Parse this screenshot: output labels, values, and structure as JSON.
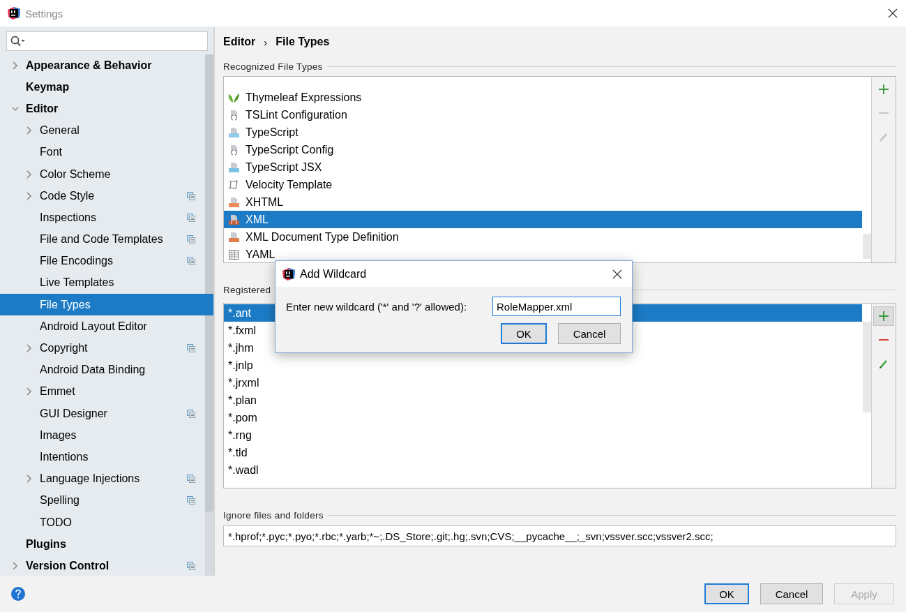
{
  "window": {
    "title": "Settings"
  },
  "sidebar": {
    "items": [
      {
        "label": "Appearance & Behavior",
        "kind": "collapsed",
        "project_level": false,
        "selected": false
      },
      {
        "label": "Keymap",
        "kind": "leaf",
        "project_level": false,
        "selected": false
      },
      {
        "label": "Editor",
        "kind": "expanded",
        "project_level": false,
        "selected": false,
        "children": [
          {
            "label": "General",
            "kind": "collapsed",
            "project_level": false,
            "selected": false
          },
          {
            "label": "Font",
            "kind": "leaf",
            "project_level": false,
            "selected": false
          },
          {
            "label": "Color Scheme",
            "kind": "collapsed",
            "project_level": false,
            "selected": false
          },
          {
            "label": "Code Style",
            "kind": "collapsed",
            "project_level": true,
            "selected": false
          },
          {
            "label": "Inspections",
            "kind": "leaf",
            "project_level": true,
            "selected": false
          },
          {
            "label": "File and Code Templates",
            "kind": "leaf",
            "project_level": true,
            "selected": false
          },
          {
            "label": "File Encodings",
            "kind": "leaf",
            "project_level": true,
            "selected": false
          },
          {
            "label": "Live Templates",
            "kind": "leaf",
            "project_level": false,
            "selected": false
          },
          {
            "label": "File Types",
            "kind": "leaf",
            "project_level": false,
            "selected": true
          },
          {
            "label": "Android Layout Editor",
            "kind": "leaf",
            "project_level": false,
            "selected": false
          },
          {
            "label": "Copyright",
            "kind": "collapsed",
            "project_level": true,
            "selected": false
          },
          {
            "label": "Android Data Binding",
            "kind": "leaf",
            "project_level": false,
            "selected": false
          },
          {
            "label": "Emmet",
            "kind": "collapsed",
            "project_level": false,
            "selected": false
          },
          {
            "label": "GUI Designer",
            "kind": "leaf",
            "project_level": true,
            "selected": false
          },
          {
            "label": "Images",
            "kind": "leaf",
            "project_level": false,
            "selected": false
          },
          {
            "label": "Intentions",
            "kind": "leaf",
            "project_level": false,
            "selected": false
          },
          {
            "label": "Language Injections",
            "kind": "collapsed",
            "project_level": true,
            "selected": false
          },
          {
            "label": "Spelling",
            "kind": "leaf",
            "project_level": true,
            "selected": false
          },
          {
            "label": "TODO",
            "kind": "leaf",
            "project_level": false,
            "selected": false
          }
        ]
      },
      {
        "label": "Plugins",
        "kind": "leaf",
        "project_level": false,
        "selected": false
      },
      {
        "label": "Version Control",
        "kind": "collapsed",
        "project_level": true,
        "selected": false
      }
    ]
  },
  "breadcrumb": {
    "items": [
      "Editor",
      "File Types"
    ],
    "separator": "›"
  },
  "recognized": {
    "title": "Recognized File Types",
    "items": [
      {
        "label": "Thymeleaf Expressions",
        "kind": "leaf",
        "selected": false
      },
      {
        "label": "TSLint Configuration",
        "kind": "config",
        "selected": false
      },
      {
        "label": "TypeScript",
        "kind": "ts",
        "selected": false
      },
      {
        "label": "TypeScript Config",
        "kind": "config",
        "selected": false
      },
      {
        "label": "TypeScript JSX",
        "kind": "tsx",
        "selected": false
      },
      {
        "label": "Velocity Template",
        "kind": "velocity",
        "selected": false
      },
      {
        "label": "XHTML",
        "kind": "xhtml",
        "selected": false
      },
      {
        "label": "XML",
        "kind": "xml",
        "selected": true
      },
      {
        "label": "XML Document Type Definition",
        "kind": "dtd",
        "selected": false
      },
      {
        "label": "YAML",
        "kind": "table",
        "selected": false
      }
    ],
    "toolbar": [
      {
        "kind": "add",
        "disabled": false,
        "highlighted": false
      },
      {
        "kind": "remove",
        "disabled": true,
        "highlighted": false
      },
      {
        "kind": "edit",
        "disabled": true,
        "highlighted": false
      }
    ]
  },
  "patterns": {
    "title": "Registered",
    "items": [
      {
        "label": "*.ant",
        "selected": true
      },
      {
        "label": "*.fxml",
        "selected": false
      },
      {
        "label": "*.jhm",
        "selected": false
      },
      {
        "label": "*.jnlp",
        "selected": false
      },
      {
        "label": "*.jrxml",
        "selected": false
      },
      {
        "label": "*.plan",
        "selected": false
      },
      {
        "label": "*.pom",
        "selected": false
      },
      {
        "label": "*.rng",
        "selected": false
      },
      {
        "label": "*.tld",
        "selected": false
      },
      {
        "label": "*.wadl",
        "selected": false
      }
    ],
    "toolbar": [
      {
        "kind": "add",
        "disabled": false,
        "highlighted": true
      },
      {
        "kind": "remove",
        "disabled": false,
        "highlighted": false
      },
      {
        "kind": "edit",
        "disabled": false,
        "highlighted": false
      }
    ]
  },
  "ignore": {
    "title": "Ignore files and folders",
    "value": "*.hprof;*.pyc;*.pyo;*.rbc;*.yarb;*~;.DS_Store;.git;.hg;.svn;CVS;__pycache__;_svn;vssver.scc;vssver2.scc;"
  },
  "footer": {
    "buttons": [
      {
        "label": "OK",
        "default": true,
        "disabled": false
      },
      {
        "label": "Cancel",
        "default": false,
        "disabled": false
      },
      {
        "label": "Apply",
        "default": false,
        "disabled": true
      }
    ]
  },
  "dialog": {
    "title": "Add Wildcard",
    "label": "Enter new wildcard ('*' and '?' allowed):",
    "value": "RoleMapper.xml",
    "buttons": [
      {
        "label": "OK",
        "default": true
      },
      {
        "label": "Cancel",
        "default": false
      }
    ]
  }
}
